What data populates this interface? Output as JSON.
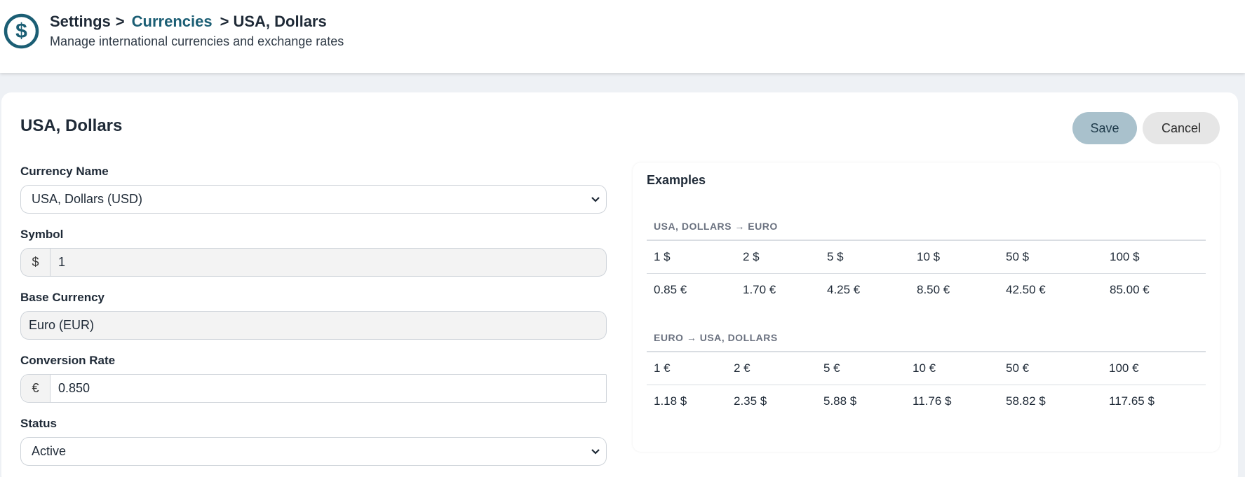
{
  "header": {
    "breadcrumb": {
      "root": "Settings",
      "sep1": ">",
      "middle": "Currencies",
      "sep2": ">",
      "current": "USA, Dollars"
    },
    "subtitle": "Manage international currencies and exchange rates",
    "logo_icon": "dollar-circle-icon",
    "accent_color": "#1b5e74"
  },
  "page": {
    "title": "USA, Dollars",
    "save_label": "Save",
    "cancel_label": "Cancel"
  },
  "form": {
    "currency_name": {
      "label": "Currency Name",
      "value": "USA, Dollars (USD)"
    },
    "symbol": {
      "label": "Symbol",
      "addon": "$",
      "value": "1"
    },
    "base_currency": {
      "label": "Base Currency",
      "value": "Euro (EUR)"
    },
    "conversion_rate": {
      "label": "Conversion Rate",
      "addon": "€",
      "value": "0.850"
    },
    "status": {
      "label": "Status",
      "value": "Active"
    }
  },
  "examples": {
    "title": "Examples",
    "tables": [
      {
        "heading": "USA, DOLLARS → EURO",
        "from": [
          "1 $",
          "2 $",
          "5 $",
          "10 $",
          "50 $",
          "100 $"
        ],
        "to": [
          "0.85 €",
          "1.70 €",
          "4.25 €",
          "8.50 €",
          "42.50 €",
          "85.00 €"
        ]
      },
      {
        "heading": "EURO → USA, DOLLARS",
        "from": [
          "1 €",
          "2 €",
          "5 €",
          "10 €",
          "50 €",
          "100 €"
        ],
        "to": [
          "1.18 $",
          "2.35 $",
          "5.88 $",
          "11.76 $",
          "58.82 $",
          "117.65 $"
        ]
      }
    ]
  }
}
